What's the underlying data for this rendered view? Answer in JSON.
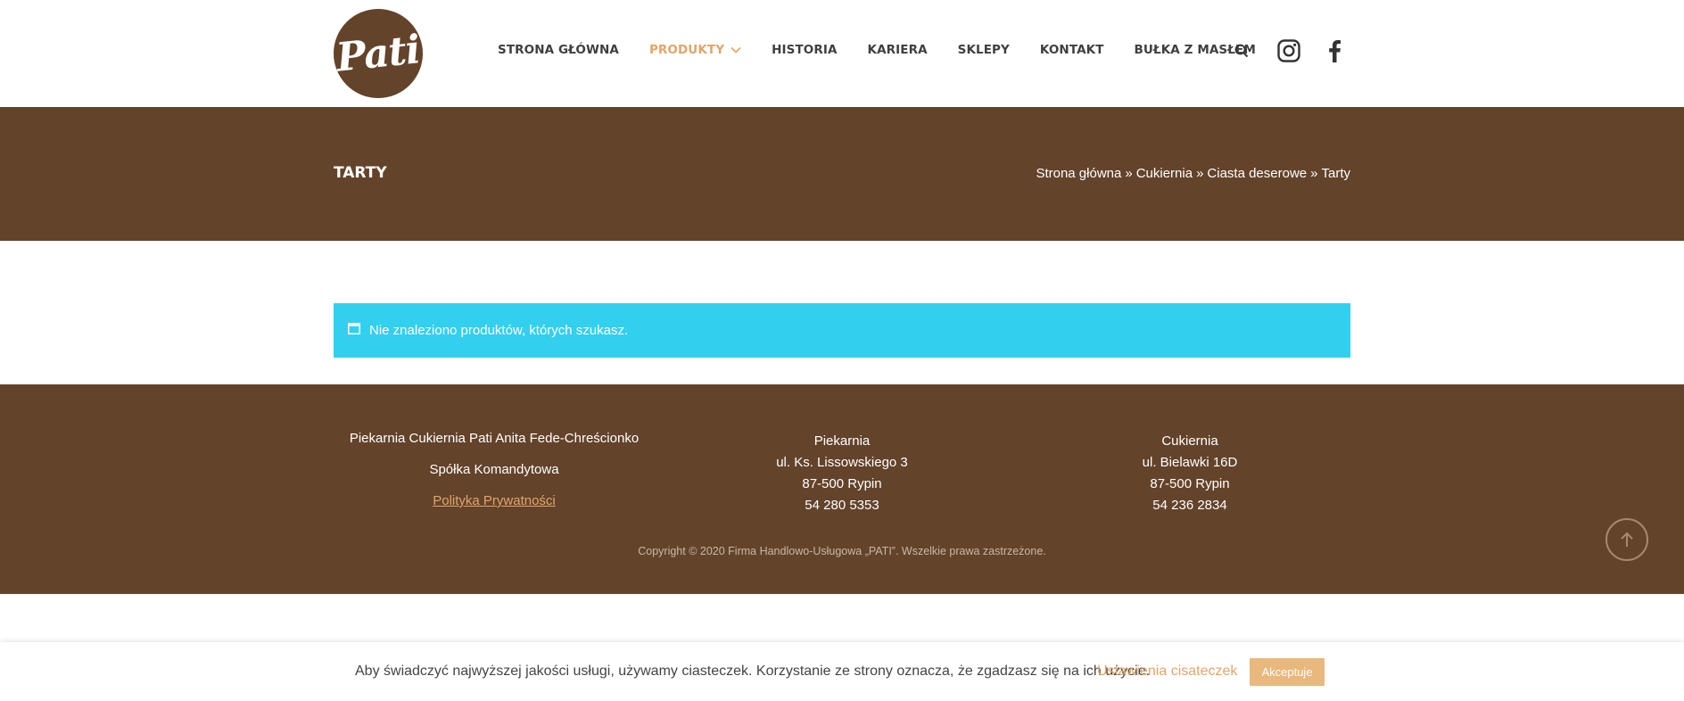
{
  "brand": {
    "logo_text": "Pati"
  },
  "nav": {
    "items": [
      {
        "label": "STRONA GŁÓWNA",
        "active": false
      },
      {
        "label": "PRODUKTY",
        "active": true,
        "has_dropdown": true
      },
      {
        "label": "HISTORIA",
        "active": false
      },
      {
        "label": "KARIERA",
        "active": false
      },
      {
        "label": "SKLEPY",
        "active": false
      },
      {
        "label": "KONTAKT",
        "active": false
      },
      {
        "label": "BUŁKA Z MASŁEM",
        "active": false
      }
    ],
    "icons": [
      "search-icon",
      "instagram-icon",
      "facebook-icon"
    ]
  },
  "page": {
    "title": "TARTY",
    "breadcrumb": [
      "Strona główna",
      "Cukiernia",
      "Ciasta deserowe",
      "Tarty"
    ],
    "breadcrumb_separator": "»"
  },
  "notice": {
    "icon": "window-icon",
    "text": "Nie znaleziono produktów, których szukasz."
  },
  "footer": {
    "company": {
      "name": "Piekarnia Cukiernia Pati Anita Fede-Chreścionko",
      "type": "Spółka Komandytowa",
      "privacy_link": "Polityka Prywatności"
    },
    "bakery": {
      "title": "Piekarnia",
      "street": "ul. Ks. Lissowskiego 3",
      "city": "87-500 Rypin",
      "phone": "54 280 5353"
    },
    "pastry": {
      "title": "Cukiernia",
      "street": "ul. Bielawki 16D",
      "city": "87-500 Rypin",
      "phone": "54 236 2834"
    },
    "copyright": "Copyright © 2020 Firma Handlowo-Usługowa „PATI”. Wszelkie prawa zastrzeżone."
  },
  "cookie": {
    "text": "Aby świadczyć najwyższej jakości usługi, używamy ciasteczek. Korzystanie ze strony oznacza, że zgadzasz się na ich użycie.",
    "settings_label": "Ustawienia cisateczek",
    "accept_label": "Akceptuje"
  },
  "colors": {
    "brown": "#63432a",
    "accent": "#e1a56a",
    "notice_blue": "#33cfee",
    "accept_button": "#e8b87d"
  }
}
